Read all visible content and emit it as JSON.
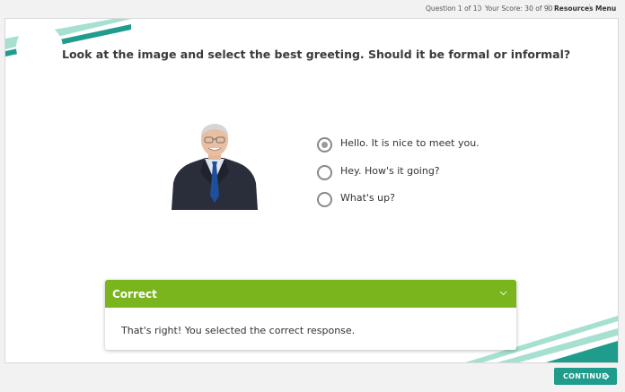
{
  "header": {
    "question_progress": "Question 1 of 10",
    "score": "Your Score: 30 of 90",
    "resources_label": "Resources",
    "menu_label": "Menu"
  },
  "question": {
    "prompt": "Look at the image and select the best greeting. Should it be formal or informal?"
  },
  "options": [
    {
      "label": "Hello. It is nice to meet you.",
      "selected": true
    },
    {
      "label": "Hey. How's it going?",
      "selected": false
    },
    {
      "label": "What's up?",
      "selected": false
    }
  ],
  "feedback": {
    "title": "Correct",
    "message": "That's right! You selected the correct response."
  },
  "footer": {
    "continue_label": "CONTINUE"
  },
  "colors": {
    "teal": "#1f9c8c",
    "mint": "#a6e0d0",
    "correct_green": "#7ab51d"
  },
  "icons": {
    "feedback_toggle": "chevron-down-icon",
    "continue_arrow": "chevron-right-icon"
  }
}
